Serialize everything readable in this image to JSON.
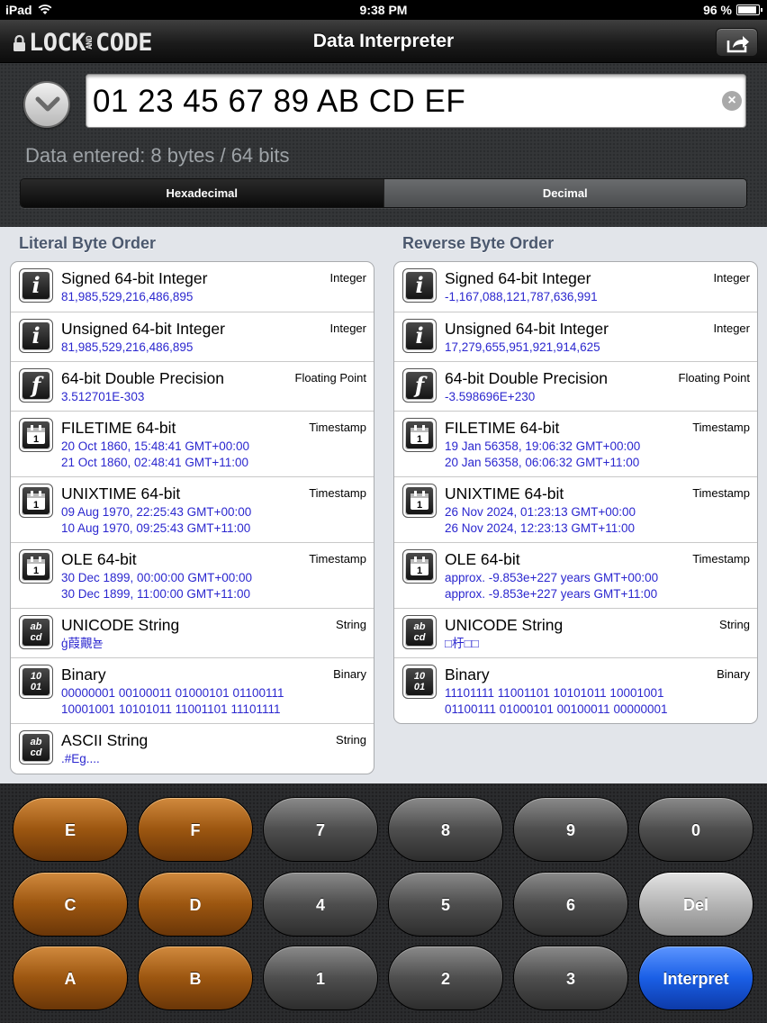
{
  "status_bar": {
    "device": "iPad",
    "time": "9:38 PM",
    "battery": "96 %",
    "battery_level": 0.96
  },
  "nav": {
    "logo_left": "LOCK",
    "logo_and": "AND",
    "logo_right": "CODE",
    "title": "Data Interpreter",
    "share_icon": "share-icon"
  },
  "input": {
    "value": "01 23 45 67 89 AB CD EF",
    "summary": "Data entered: 8 bytes / 64 bits"
  },
  "mode": {
    "hex_label": "Hexadecimal",
    "dec_label": "Decimal",
    "selected": "Hexadecimal"
  },
  "literal": {
    "title": "Literal Byte Order",
    "rows": [
      {
        "icon": "integer-icon",
        "name": "Signed 64-bit Integer",
        "type": "Integer",
        "lines": [
          "81,985,529,216,486,895"
        ]
      },
      {
        "icon": "integer-icon",
        "name": "Unsigned 64-bit Integer",
        "type": "Integer",
        "lines": [
          "81,985,529,216,486,895"
        ]
      },
      {
        "icon": "float-icon",
        "name": "64-bit Double Precision",
        "type": "Floating Point",
        "lines": [
          "3.512701E-303"
        ]
      },
      {
        "icon": "calendar-icon",
        "name": "FILETIME 64-bit",
        "type": "Timestamp",
        "lines": [
          "20 Oct 1860, 15:48:41 GMT+00:00",
          "21 Oct 1860, 02:48:41 GMT+11:00"
        ]
      },
      {
        "icon": "calendar-icon",
        "name": "UNIXTIME 64-bit",
        "type": "Timestamp",
        "lines": [
          "09 Aug 1970, 22:25:43 GMT+00:00",
          "10 Aug 1970, 09:25:43 GMT+11:00"
        ]
      },
      {
        "icon": "calendar-icon",
        "name": "OLE 64-bit",
        "type": "Timestamp",
        "lines": [
          "30 Dec 1899, 00:00:00 GMT+00:00",
          "30 Dec 1899, 11:00:00 GMT+11:00"
        ]
      },
      {
        "icon": "string-icon",
        "name": "UNICODE String",
        "type": "String",
        "lines": [
          "ģ葭覿뇯"
        ]
      },
      {
        "icon": "binary-icon",
        "name": "Binary",
        "type": "Binary",
        "lines": [
          "00000001 00100011 01000101 01100111",
          "10001001 10101011 11001101 11101111"
        ]
      },
      {
        "icon": "string-icon",
        "name": "ASCII String",
        "type": "String",
        "lines": [
          ".#Eg...."
        ]
      }
    ]
  },
  "reverse": {
    "title": "Reverse Byte Order",
    "rows": [
      {
        "icon": "integer-icon",
        "name": "Signed 64-bit Integer",
        "type": "Integer",
        "lines": [
          "-1,167,088,121,787,636,991"
        ]
      },
      {
        "icon": "integer-icon",
        "name": "Unsigned 64-bit Integer",
        "type": "Integer",
        "lines": [
          "17,279,655,951,921,914,625"
        ]
      },
      {
        "icon": "float-icon",
        "name": "64-bit Double Precision",
        "type": "Floating Point",
        "lines": [
          "-3.598696E+230"
        ]
      },
      {
        "icon": "calendar-icon",
        "name": "FILETIME 64-bit",
        "type": "Timestamp",
        "lines": [
          "19 Jan 56358, 19:06:32 GMT+00:00",
          "20 Jan 56358, 06:06:32 GMT+11:00"
        ]
      },
      {
        "icon": "calendar-icon",
        "name": "UNIXTIME 64-bit",
        "type": "Timestamp",
        "lines": [
          "26 Nov 2024, 01:23:13 GMT+00:00",
          "26 Nov 2024, 12:23:13 GMT+11:00"
        ]
      },
      {
        "icon": "calendar-icon",
        "name": "OLE 64-bit",
        "type": "Timestamp",
        "lines": [
          "approx. -9.853e+227 years GMT+00:00",
          "approx. -9.853e+227 years GMT+11:00"
        ]
      },
      {
        "icon": "string-icon",
        "name": "UNICODE String",
        "type": "String",
        "lines": [
          "□杅□□"
        ]
      },
      {
        "icon": "binary-icon",
        "name": "Binary",
        "type": "Binary",
        "lines": [
          "11101111 11001101 10101011 10001001",
          "01100111 01000101 00100011 00000001"
        ]
      }
    ]
  },
  "keypad": {
    "rows": [
      [
        "E",
        "F",
        "7",
        "8",
        "9",
        "0"
      ],
      [
        "C",
        "D",
        "4",
        "5",
        "6",
        "Del"
      ],
      [
        "A",
        "B",
        "1",
        "2",
        "3",
        "Interpret"
      ]
    ]
  },
  "colors": {
    "value_text": "#2b27cf",
    "section_title": "#4b586e",
    "hex_key": "#9c5610",
    "interpret_key": "#1a5fe6"
  }
}
